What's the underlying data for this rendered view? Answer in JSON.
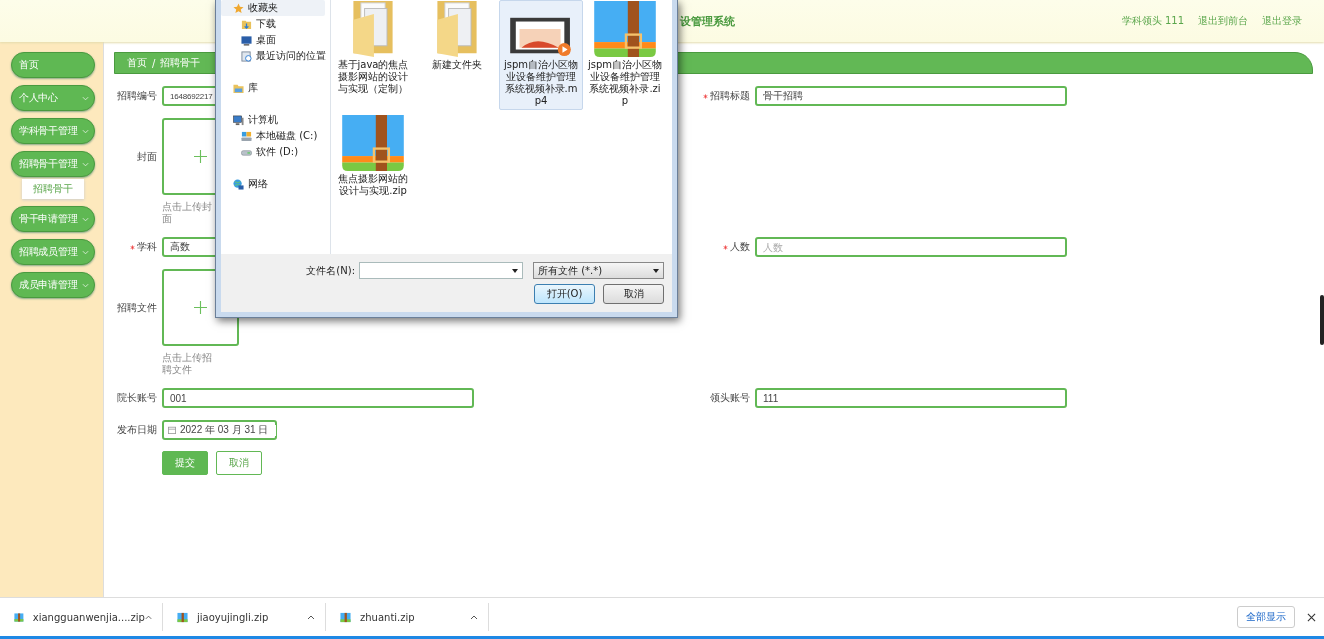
{
  "header": {
    "title": "设管理系统",
    "links": [
      "学科领头 111",
      "退出到前台",
      "退出登录"
    ]
  },
  "sidebar": {
    "items": [
      {
        "label": "首页",
        "kind": "link"
      },
      {
        "label": "个人中心",
        "kind": "menu"
      },
      {
        "label": "学科骨干管理",
        "kind": "menu"
      },
      {
        "label": "招聘骨干管理",
        "kind": "menu",
        "children": [
          {
            "label": "招聘骨干"
          }
        ]
      },
      {
        "label": "骨干申请管理",
        "kind": "menu"
      },
      {
        "label": "招聘成员管理",
        "kind": "menu"
      },
      {
        "label": "成员申请管理",
        "kind": "menu"
      }
    ]
  },
  "breadcrumb": {
    "items": [
      "首页",
      "招聘骨干"
    ],
    "separator": "/"
  },
  "form": {
    "rows": [
      {
        "fields": [
          {
            "kind": "text",
            "label": "招聘编号",
            "required": false,
            "value": "1648692217"
          },
          {
            "kind": "text",
            "label": "招聘标题",
            "required": true,
            "value": "骨干招聘"
          }
        ]
      },
      {
        "fields": [
          {
            "kind": "upload",
            "label": "封面",
            "required": false,
            "hint": "点击上传封面"
          }
        ]
      },
      {
        "fields": [
          {
            "kind": "text",
            "label": "学科",
            "required": true,
            "value": "高数"
          },
          {
            "kind": "text",
            "label": "人数",
            "required": true,
            "placeholder": "人数"
          }
        ]
      },
      {
        "fields": [
          {
            "kind": "upload",
            "label": "招聘文件",
            "required": false,
            "hint": "点击上传招聘文件"
          }
        ]
      },
      {
        "fields": [
          {
            "kind": "text",
            "label": "院长账号",
            "required": false,
            "value": "001"
          },
          {
            "kind": "text",
            "label": "领头账号",
            "required": false,
            "value": "111"
          }
        ]
      },
      {
        "fields": [
          {
            "kind": "date",
            "label": "发布日期",
            "required": false,
            "value": "2022 年 03 月 31 日"
          }
        ]
      }
    ],
    "buttons": [
      {
        "label": "提交",
        "kind": "primary"
      },
      {
        "label": "取消",
        "kind": "secondary"
      }
    ]
  },
  "dialog": {
    "nav": [
      {
        "label": "收藏夹",
        "kind": "star",
        "selected": true,
        "children": [
          {
            "label": "下载",
            "kind": "download",
            "selected": false
          },
          {
            "label": "桌面",
            "kind": "desktop",
            "selected": false
          },
          {
            "label": "最近访问的位置",
            "kind": "recent",
            "selected": false
          }
        ]
      },
      {
        "label": "库",
        "kind": "library",
        "selected": false
      },
      {
        "label": "计算机",
        "kind": "computer",
        "selected": false,
        "children": [
          {
            "label": "本地磁盘 (C:)",
            "kind": "drive",
            "selected": false
          },
          {
            "label": "软件 (D:)",
            "kind": "disc",
            "selected": false
          }
        ]
      },
      {
        "label": "网络",
        "kind": "network",
        "selected": false
      }
    ],
    "files": [
      {
        "name": "基于java的焦点摄影网站的设计与实现（定制）",
        "kind": "folder",
        "selected": false
      },
      {
        "name": "新建文件夹",
        "kind": "folder",
        "selected": false
      },
      {
        "name": "jspm自治小区物业设备维护管理系统视频补录.mp4",
        "kind": "video",
        "selected": true
      },
      {
        "name": "jspm自治小区物业设备维护管理系统视频补录.zip",
        "kind": "zip",
        "selected": false
      },
      {
        "name": "焦点摄影网站的设计与实现.zip",
        "kind": "zip",
        "selected": false
      }
    ],
    "filename_label": "文件名(N):",
    "filter": "所有文件 (*.*)",
    "buttons": [
      "打开(O)",
      "取消"
    ]
  },
  "downloads": {
    "items": [
      {
        "name": "xiangguanwenjia....zip"
      },
      {
        "name": "jiaoyujingli.zip"
      },
      {
        "name": "zhuanti.zip"
      }
    ],
    "show_all": "全部显示"
  }
}
